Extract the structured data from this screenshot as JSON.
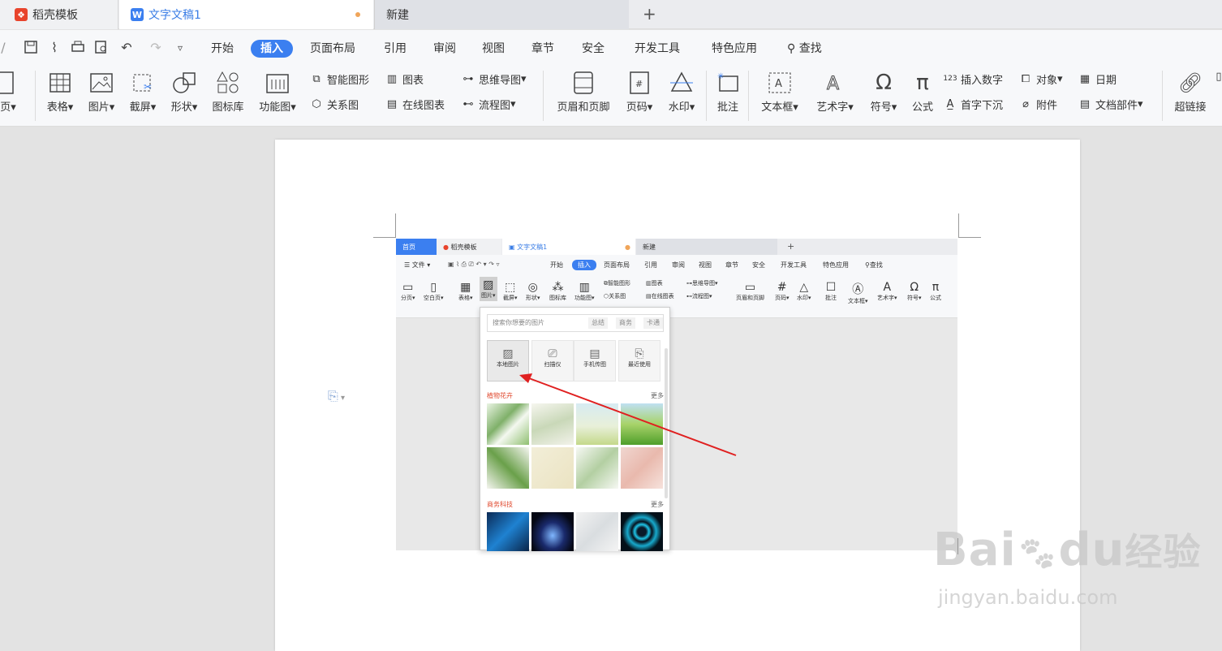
{
  "tabs": [
    {
      "label": "稻壳模板"
    },
    {
      "label": "文字文稿1"
    },
    {
      "label": "新建"
    }
  ],
  "quick_menu": [
    "开始",
    "插入",
    "页面布局",
    "引用",
    "审阅",
    "视图",
    "章节",
    "安全",
    "开发工具",
    "特色应用"
  ],
  "search_label": "查找",
  "ribbon": {
    "page_frag": "页",
    "table": "表格",
    "picture": "图片",
    "screenshot": "截屏",
    "shape": "形状",
    "iconlib": "图标库",
    "funcchart": "功能图",
    "smartart": "智能图形",
    "chart": "图表",
    "mindmap": "思维导图",
    "relation": "关系图",
    "onlinechart": "在线图表",
    "flowchart": "流程图",
    "headerfooter": "页眉和页脚",
    "pagenum": "页码",
    "watermark": "水印",
    "comment": "批注",
    "textbox": "文本框",
    "arttext": "艺术字",
    "symbol": "符号",
    "formula": "公式",
    "insertnum": "插入数字",
    "object": "对象",
    "date": "日期",
    "dropcap": "首字下沉",
    "attach": "附件",
    "docpart": "文档部件",
    "hyperlink": "超链接"
  },
  "embedded": {
    "tabs": [
      "首页",
      "稻壳模板",
      "文字文稿1",
      "新建"
    ],
    "menu": [
      "文件",
      "开始",
      "插入",
      "页面布局",
      "引用",
      "审阅",
      "视图",
      "章节",
      "安全",
      "开发工具",
      "特色应用",
      "查找"
    ],
    "ribbon": [
      "分页",
      "空白页",
      "表格",
      "图片",
      "截屏",
      "形状",
      "图标库",
      "功能图",
      "智能图形",
      "图表",
      "思维导图",
      "关系图",
      "在线图表",
      "流程图",
      "页眉和页脚",
      "页码",
      "水印",
      "批注",
      "文本框",
      "艺术字",
      "符号",
      "公式"
    ],
    "panel": {
      "search_placeholder": "搜索你想要的图片",
      "chips": [
        "总结",
        "商务",
        "卡通"
      ],
      "sources": [
        "本地图片",
        "扫描仪",
        "手机传图",
        "最近使用"
      ],
      "section1": "植物花卉",
      "section2": "商务科技",
      "more": "更多"
    }
  },
  "watermark": {
    "brand": "Bai",
    "du": "du",
    "cn": "经验",
    "url": "jingyan.baidu.com"
  },
  "colors": {
    "accent": "#3b7ff0",
    "annotation_arrow": "#e02020"
  }
}
